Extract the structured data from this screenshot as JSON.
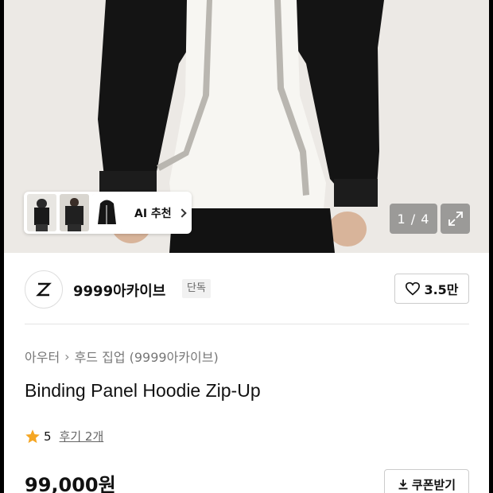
{
  "hero": {
    "ai_label": "AI 추천",
    "counter": "1 / 4",
    "thumbnails": [
      "front-view",
      "styled-look",
      "product-flat"
    ]
  },
  "brand": {
    "name": "9999아카이브",
    "badge": "단독",
    "likes": "3.5만"
  },
  "product": {
    "breadcrumb": [
      "아우터",
      "후드 집업 (9999아카이브)"
    ],
    "title": "Binding Panel Hoodie Zip-Up",
    "rating": "5",
    "reviews": "후기 2개",
    "price": "99,000원",
    "coupon_label": "쿠폰받기"
  },
  "colors": {
    "star": "#f5a623",
    "text": "#111111",
    "muted": "#777777"
  }
}
